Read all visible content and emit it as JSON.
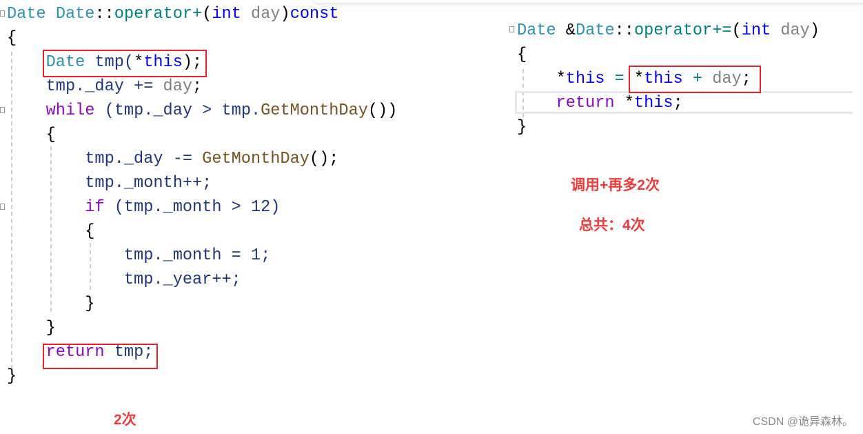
{
  "colors": {
    "type": "#2b91af",
    "keyword": "#0000ff",
    "control": "#8f08c4",
    "param": "#808080",
    "function": "#74531f",
    "annotation": "#f03a3a",
    "highlight_box": "#e8212b"
  },
  "left_code": [
    [
      [
        "Date",
        "type"
      ],
      [
        " ",
        "plain"
      ],
      [
        "Date",
        "type"
      ],
      [
        "::",
        "plain"
      ],
      [
        "operator+",
        "op"
      ],
      [
        "(",
        "plain"
      ],
      [
        "int",
        "kw"
      ],
      [
        " ",
        "plain"
      ],
      [
        "day",
        "param"
      ],
      [
        ")",
        "plain"
      ],
      [
        "const",
        "kw"
      ]
    ],
    [
      [
        "{",
        "plain"
      ]
    ],
    [
      [
        "    ",
        "plain"
      ],
      [
        "Date",
        "type"
      ],
      [
        " tmp(",
        "local"
      ],
      [
        "*",
        "plain"
      ],
      [
        "this",
        "kw"
      ],
      [
        ");",
        "plain"
      ]
    ],
    [
      [
        "    tmp._day += ",
        "local"
      ],
      [
        "day",
        "param"
      ],
      [
        ";",
        "plain"
      ]
    ],
    [
      [
        "    ",
        "plain"
      ],
      [
        "while",
        "ctl"
      ],
      [
        " (tmp._day > tmp.",
        "local"
      ],
      [
        "GetMonthDay",
        "fn"
      ],
      [
        "())",
        "plain"
      ]
    ],
    [
      [
        "    {",
        "plain"
      ]
    ],
    [
      [
        "        tmp._day -= ",
        "local"
      ],
      [
        "GetMonthDay",
        "fn"
      ],
      [
        "();",
        "plain"
      ]
    ],
    [
      [
        "        tmp._month++;",
        "local"
      ]
    ],
    [
      [
        "        ",
        "plain"
      ],
      [
        "if",
        "ctl"
      ],
      [
        " (tmp._month > 12)",
        "local"
      ]
    ],
    [
      [
        "        {",
        "plain"
      ]
    ],
    [
      [
        "            tmp._month = 1;",
        "local"
      ]
    ],
    [
      [
        "            tmp._year++;",
        "local"
      ]
    ],
    [
      [
        "        }",
        "plain"
      ]
    ],
    [
      [
        "    }",
        "plain"
      ]
    ],
    [
      [
        "    ",
        "plain"
      ],
      [
        "return",
        "ctl"
      ],
      [
        " tmp;",
        "local"
      ]
    ],
    [
      [
        "}",
        "plain"
      ]
    ]
  ],
  "right_code": [
    [
      [
        "Date",
        "type"
      ],
      [
        " &",
        "plain"
      ],
      [
        "Date",
        "type"
      ],
      [
        "::",
        "plain"
      ],
      [
        "operator+=",
        "op"
      ],
      [
        "(",
        "plain"
      ],
      [
        "int",
        "kw"
      ],
      [
        " ",
        "plain"
      ],
      [
        "day",
        "param"
      ],
      [
        ")",
        "plain"
      ]
    ],
    [
      [
        "{",
        "plain"
      ]
    ],
    [
      [
        "    *",
        "plain"
      ],
      [
        "this",
        "kw"
      ],
      [
        " = ",
        "op"
      ],
      [
        "*",
        "plain"
      ],
      [
        "this",
        "kw"
      ],
      [
        " + ",
        "op"
      ],
      [
        "day",
        "param"
      ],
      [
        ";",
        "plain"
      ]
    ],
    [
      [
        "    ",
        "plain"
      ],
      [
        "return",
        "ctl"
      ],
      [
        " *",
        "plain"
      ],
      [
        "this",
        "kw"
      ],
      [
        ";",
        "plain"
      ]
    ],
    [
      [
        "}",
        "plain"
      ]
    ]
  ],
  "notes": {
    "right_extra": "调用+再多2次",
    "total": "总共：4次",
    "left_count": "2次"
  },
  "watermark": "CSDN @诡异森林。"
}
